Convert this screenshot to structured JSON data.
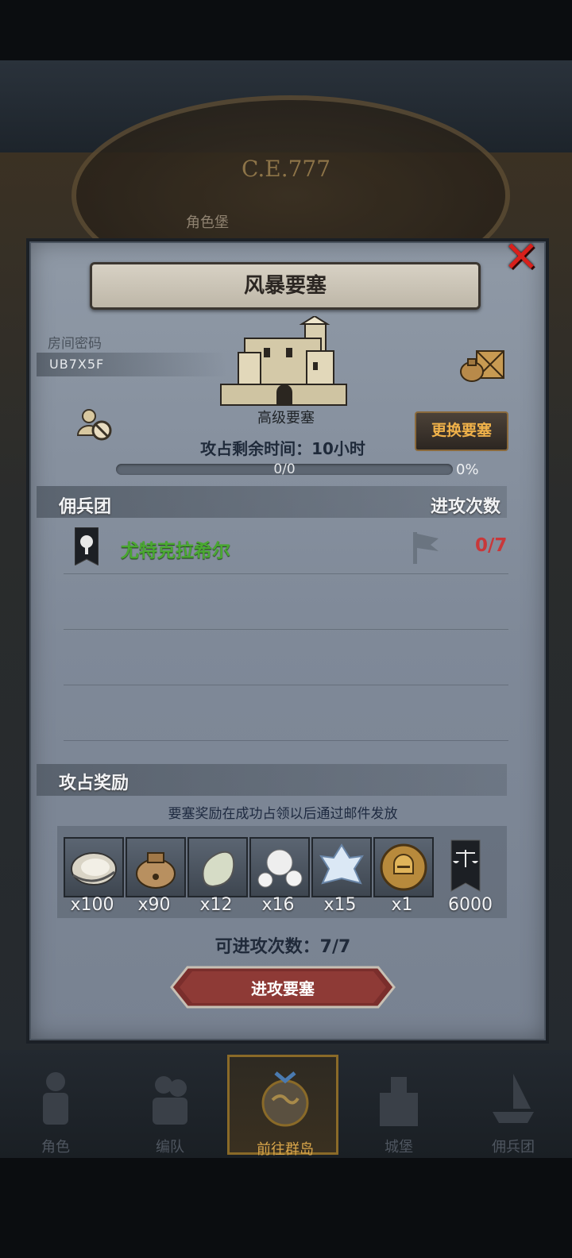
{
  "background": {
    "era_label": "C.E.777",
    "castle_label": "角色堡"
  },
  "dialog": {
    "title": "风暴要塞",
    "room": {
      "label": "房间密码",
      "code": "UB7X5F"
    },
    "fortress_level": "高级要塞",
    "change_button": "更换要塞",
    "time_remaining": "攻占剩余时间：10小时",
    "progress": {
      "text": "0/0",
      "percent_label": "0%",
      "fraction": 0
    },
    "mercenary_header": "佣兵团",
    "attack_header": "进攻次数",
    "guilds": [
      {
        "name": "尤特克拉希尔",
        "attacks": "0/7"
      }
    ],
    "rewards_header": "攻占奖励",
    "reward_note": "要塞奖励在成功占领以后通过邮件发放",
    "rewards": [
      {
        "icon": "oyster-icon",
        "qty": "x100"
      },
      {
        "icon": "sack-icon",
        "qty": "x90"
      },
      {
        "icon": "pebble-icon",
        "qty": "x12"
      },
      {
        "icon": "pearls-icon",
        "qty": "x16"
      },
      {
        "icon": "ice-crystal-icon",
        "qty": "x15"
      },
      {
        "icon": "helmet-medal-icon",
        "qty": "x1"
      },
      {
        "icon": "scales-banner-icon",
        "qty": "6000"
      }
    ],
    "attempts": "可进攻次数：7/7",
    "attack_button": "进攻要塞"
  },
  "nav": [
    {
      "label": "角色",
      "icon": "knight-icon"
    },
    {
      "label": "编队",
      "icon": "team-icon"
    },
    {
      "label": "前往群岛",
      "icon": "globe-icon"
    },
    {
      "label": "城堡",
      "icon": "castle-icon"
    },
    {
      "label": "佣兵团",
      "icon": "ship-icon"
    }
  ],
  "colors": {
    "accent_gold": "#d9a64a",
    "guild_green": "#4aa832",
    "count_red": "#c8383a",
    "close_red": "#d8201c"
  }
}
